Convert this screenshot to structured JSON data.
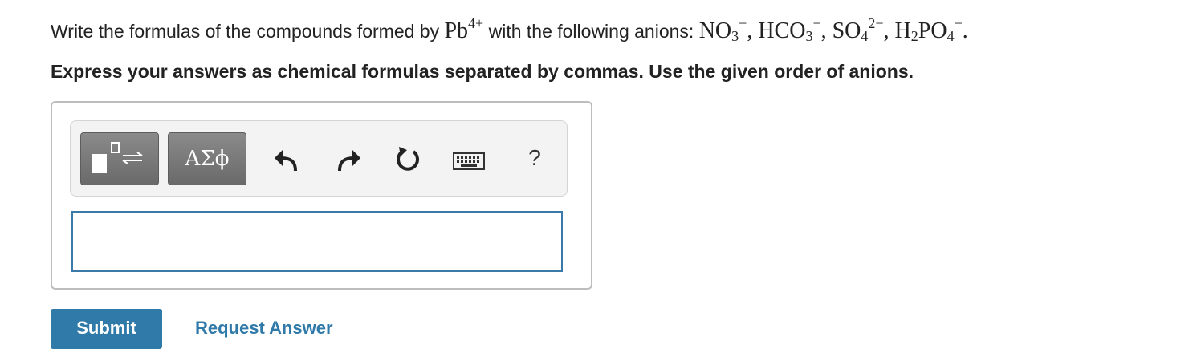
{
  "question": {
    "text_before": "Write the formulas of the compounds formed by ",
    "cation": {
      "symbol": "Pb",
      "charge": "4+"
    },
    "text_middle": " with the following anions: ",
    "anions": [
      {
        "p1": "NO",
        "s1": "3",
        "p2": "",
        "s2": "",
        "charge": "−"
      },
      {
        "p1": "HCO",
        "s1": "3",
        "p2": "",
        "s2": "",
        "charge": "−"
      },
      {
        "p1": "SO",
        "s1": "4",
        "p2": "",
        "s2": "",
        "charge": "2−"
      },
      {
        "p1": "H",
        "s1": "2",
        "p2": "PO",
        "s2": "4",
        "charge": "−"
      }
    ],
    "separator": ", ",
    "end": "."
  },
  "instruction": "Express your answers as chemical formulas separated by commas. Use the given order of anions.",
  "toolbar": {
    "symbols_label": "ΑΣϕ",
    "help_label": "?"
  },
  "answer": {
    "value": ""
  },
  "actions": {
    "submit_label": "Submit",
    "request_label": "Request Answer"
  }
}
